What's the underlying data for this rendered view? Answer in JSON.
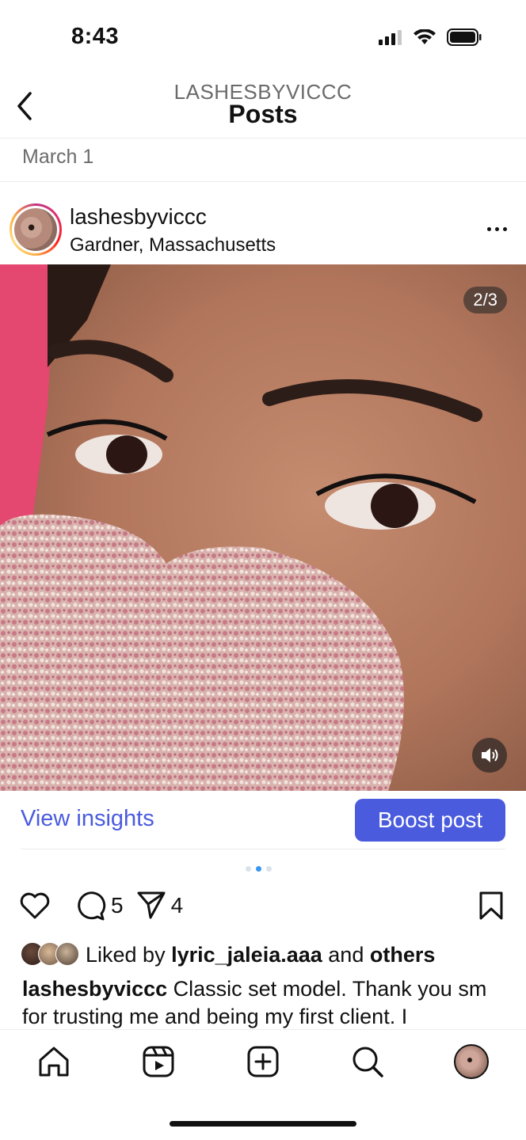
{
  "status_bar": {
    "time": "8:43"
  },
  "header": {
    "username": "LASHESBYVICCC",
    "title": "Posts"
  },
  "date": "March 1",
  "post": {
    "username": "lashesbyviccc",
    "location": "Gardner, Massachusetts",
    "carousel_counter": "2/3",
    "carousel": {
      "total": 3,
      "current": 2
    }
  },
  "actions": {
    "view_insights": "View insights",
    "boost_post": "Boost post",
    "comment_count": "5",
    "share_count": "4"
  },
  "likes": {
    "prefix": "Liked by",
    "user": "lyric_jaleia.aaa",
    "joiner": "and",
    "others": "others"
  },
  "caption": {
    "username": "lashesbyviccc",
    "text": "Classic set model. Thank you sm for trusting me and being my first client. I"
  },
  "colors": {
    "accent_blue": "#4a5bde",
    "dot_active": "#3897f0"
  },
  "nav": {
    "items": [
      "home-icon",
      "reels-icon",
      "create-icon",
      "search-icon",
      "profile-avatar"
    ]
  }
}
